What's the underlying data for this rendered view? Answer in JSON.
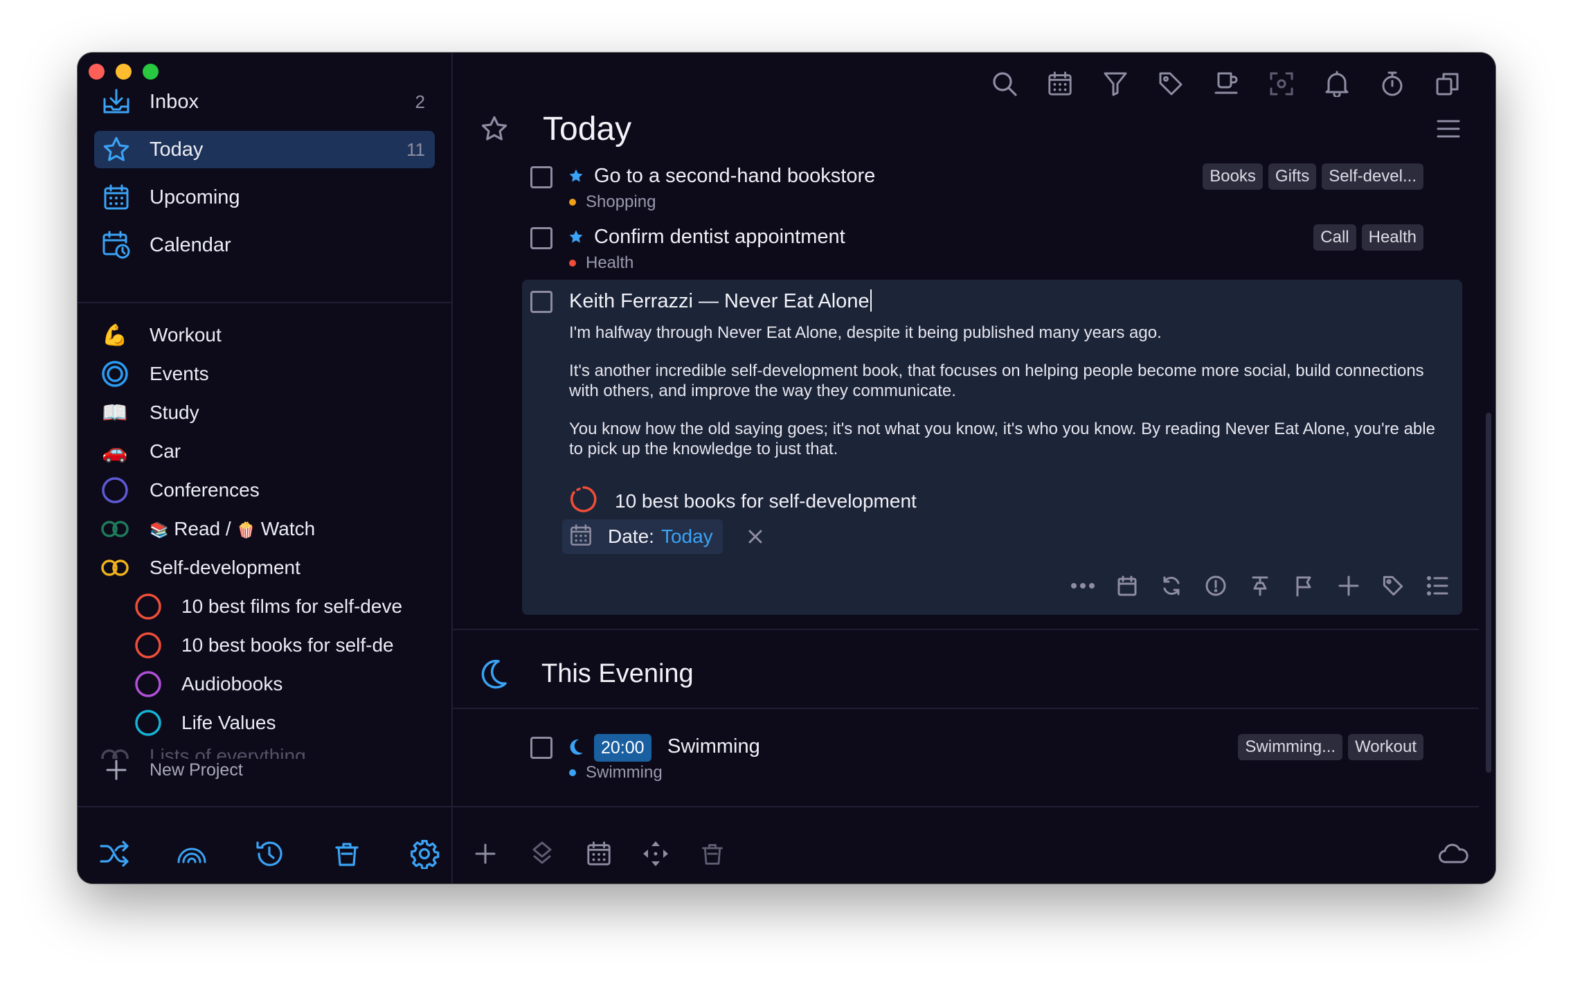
{
  "sidebar": {
    "nav": [
      {
        "label": "Inbox",
        "count": "2",
        "icon": "inbox-icon"
      },
      {
        "label": "Today",
        "count": "11",
        "icon": "star-icon"
      },
      {
        "label": "Upcoming",
        "count": "",
        "icon": "calendar-grid-icon"
      },
      {
        "label": "Calendar",
        "count": "",
        "icon": "calendar-clock-icon"
      }
    ],
    "projects": [
      {
        "label": "Workout",
        "icon": "flexed-biceps-emoji"
      },
      {
        "label": "Events",
        "icon": "target-ring-icon"
      },
      {
        "label": "Study",
        "icon": "open-book-emoji"
      },
      {
        "label": "Car",
        "icon": "car-emoji"
      },
      {
        "label": "Conferences",
        "icon": "circle-icon"
      },
      {
        "label": "Read / ",
        "label2": "Watch",
        "icon": "linked-rings-icon"
      },
      {
        "label": "Self-development",
        "icon": "linked-rings-icon"
      },
      {
        "label": "10 best films for self-deve",
        "icon": "circle-icon"
      },
      {
        "label": "10 best books for self-de",
        "icon": "circle-icon"
      },
      {
        "label": "Audiobooks",
        "icon": "circle-icon"
      },
      {
        "label": "Life Values",
        "icon": "circle-icon"
      },
      {
        "label": "Lists of everything",
        "icon": "linked-rings-icon"
      }
    ],
    "new_project": "New Project",
    "emoji": {
      "workout": "💪",
      "study": "📖",
      "car": "🚗",
      "books": "📚",
      "popcorn": "🍿"
    }
  },
  "main": {
    "title": "Today",
    "tasks": [
      {
        "title": "Go to a second-hand bookstore",
        "project": "Shopping",
        "project_color": "#f0a018",
        "tags": [
          "Books",
          "Gifts",
          "Self-devel..."
        ]
      },
      {
        "title": "Confirm dentist appointment",
        "project": "Health",
        "project_color": "#ee4e38",
        "tags": [
          "Call",
          "Health"
        ]
      }
    ],
    "detail": {
      "title": "Keith Ferrazzi — Never Eat Alone",
      "notes": [
        "I'm halfway through Never Eat Alone, despite it being published many years ago.",
        "It's another incredible self-development book, that focuses on helping people become more social, build connections with others, and improve the way they communicate.",
        "You know how the old saying goes; it's not what you know, it's who you know. By reading Never Eat Alone, you're able to pick up the knowledge to just that."
      ],
      "project": "10 best books for self-development",
      "date_label": "Date:",
      "date_value": "Today"
    },
    "evening": {
      "title": "This Evening",
      "task": {
        "time": "20:00",
        "title": "Swimming",
        "project": "Swimming",
        "project_color": "#3ba3f5",
        "tags": [
          "Swimming...",
          "Workout"
        ]
      }
    }
  },
  "colors": {
    "accent": "#3ba3f5",
    "active_bg": "#1e3359",
    "window_bg": "#0d0b1a",
    "detail_bg": "#1c2438"
  }
}
